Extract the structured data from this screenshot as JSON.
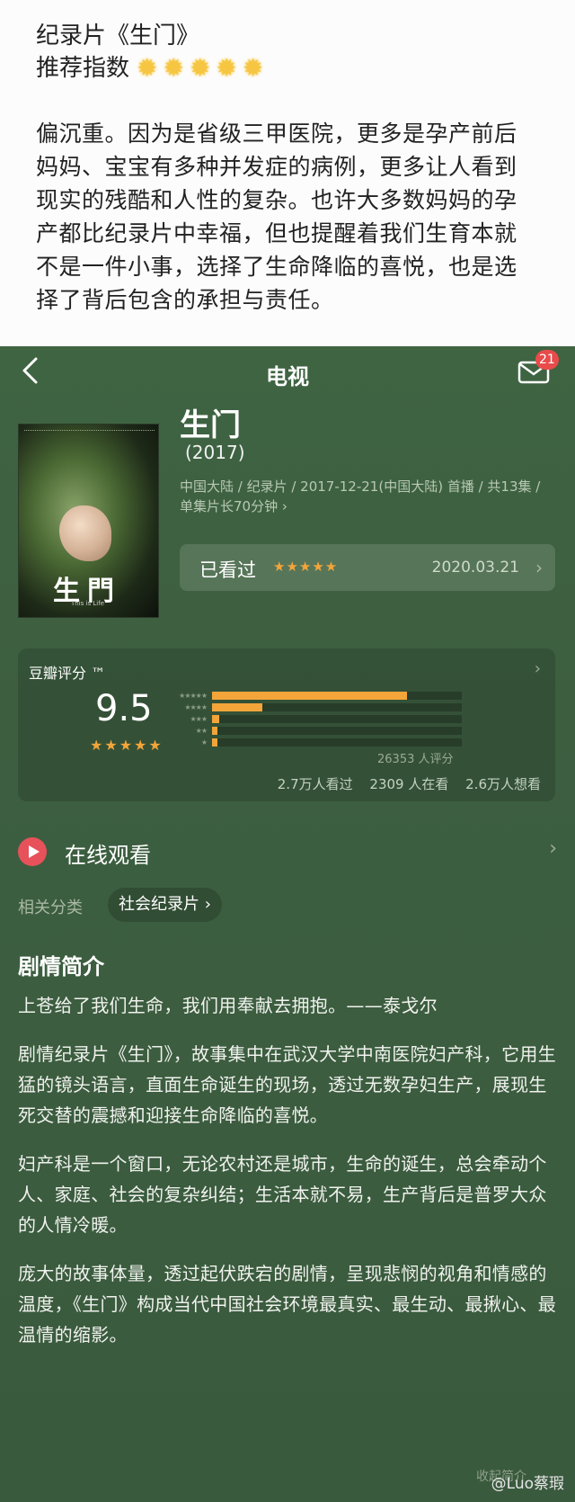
{
  "post": {
    "title": "纪录片《生门》",
    "recommend_label": "推荐指数",
    "recommend_stars": 5,
    "body": "偏沉重。因为是省级三甲医院，更多是孕产前后妈妈、宝宝有多种并发症的病例，更多让人看到现实的残酷和人性的复杂。也许大多数妈妈的孕产都比纪录片中幸福，但也提醒着我们生育本就不是一件小事，选择了生命降临的喜悦，也是选择了背后包含的承担与责任。"
  },
  "nav": {
    "title": "电视",
    "badge": "21"
  },
  "movie": {
    "poster_title": "生門",
    "poster_sub": "This is Life",
    "title": "生门",
    "year": "(2017)",
    "meta": "中国大陆 / 纪录片 / 2017-12-21(中国大陆) 首播 / 共13集 / 单集片长70分钟 ›",
    "watched_label": "已看过",
    "watched_stars": "★★★★★",
    "watched_date": "2020.03.21"
  },
  "rating": {
    "label": "豆瓣评分 ™",
    "score": "9.5",
    "stars": "★★★★★",
    "distribution": [
      {
        "stars": "★★★★★",
        "fraction": 0.78
      },
      {
        "stars": "★★★★",
        "fraction": 0.2
      },
      {
        "stars": "★★★",
        "fraction": 0.03
      },
      {
        "stars": "★★",
        "fraction": 0.02
      },
      {
        "stars": "★",
        "fraction": 0.02
      }
    ],
    "count": "26353 人评分",
    "watched": "2.7万人看过",
    "watching": "2309 人在看",
    "want": "2.6万人想看"
  },
  "online": {
    "label": "在线观看"
  },
  "category": {
    "label": "相关分类",
    "chip": "社会纪录片 ›"
  },
  "synopsis": {
    "heading": "剧情简介",
    "paragraphs": [
      "上苍给了我们生命，我们用奉献去拥抱。——泰戈尔",
      "剧情纪录片《生门》，故事集中在武汉大学中南医院妇产科，它用生猛的镜头语言，直面生命诞生的现场，透过无数孕妇生产，展现生死交替的震撼和迎接生命降临的喜悦。",
      "妇产科是一个窗口，无论农村还是城市，生命的诞生，总会牵动个人、家庭、社会的复杂纠结；生活本就不易，生产背后是普罗大众的人情冷暖。",
      "庞大的故事体量，透过起伏跌宕的剧情，呈现悲悯的视角和情感的温度，《生门》构成当代中国社会环境最真实、最生动、最揪心、最温情的缩影。"
    ]
  },
  "footer": {
    "fold": "收起简介",
    "watermark": "@Luo蔡瑕"
  }
}
